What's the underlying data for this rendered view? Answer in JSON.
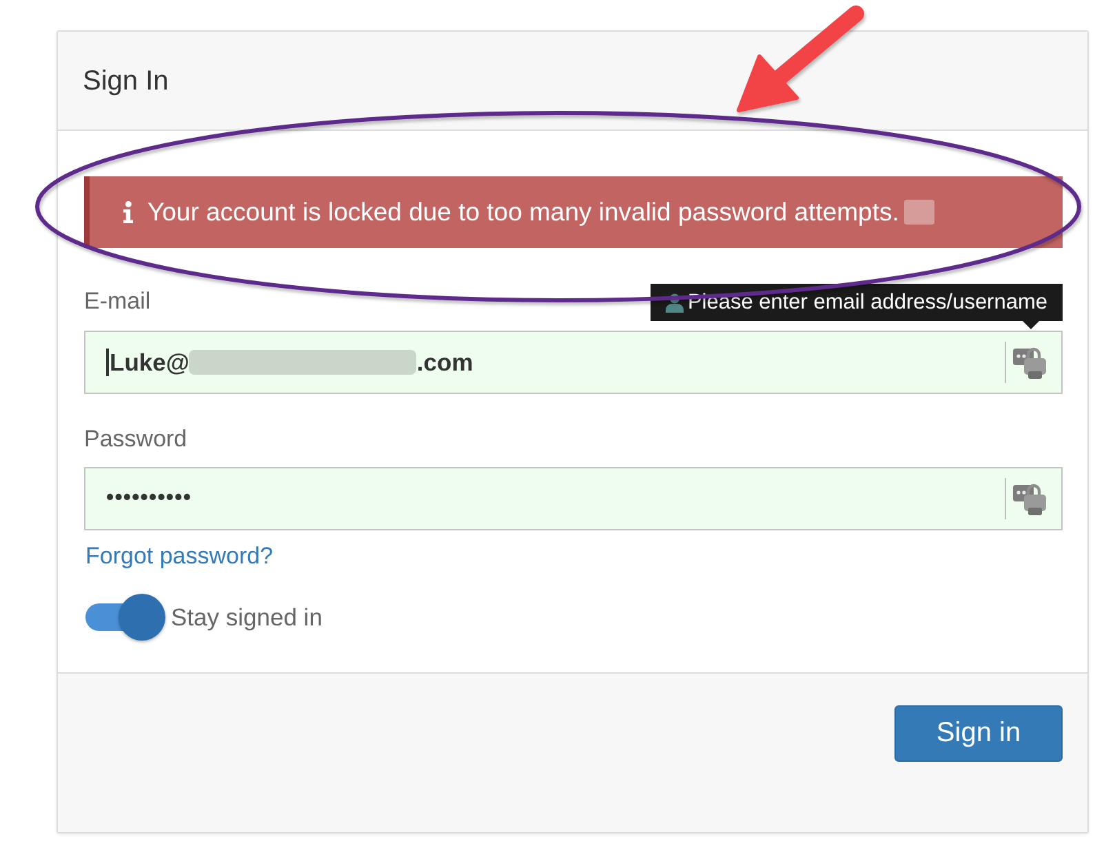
{
  "panel": {
    "title": "Sign In"
  },
  "alert": {
    "kind": "error",
    "message": "Your account is locked due to too many invalid password attempts.",
    "redacted": true
  },
  "fields": [
    {
      "kind": "email",
      "label": "E-mail",
      "value": "Luke@",
      "value_end": ".com",
      "redacted": true,
      "autofilled": true,
      "focused": true,
      "tooltip": "Please enter email address/username"
    },
    {
      "kind": "password",
      "label": "Password",
      "value": "••••••••••",
      "autofilled": true,
      "focused": false
    }
  ],
  "forgot_link": "Forgot password?",
  "toggle": {
    "label": "Stay signed in",
    "on": true
  },
  "submit_button": "Sign in"
}
